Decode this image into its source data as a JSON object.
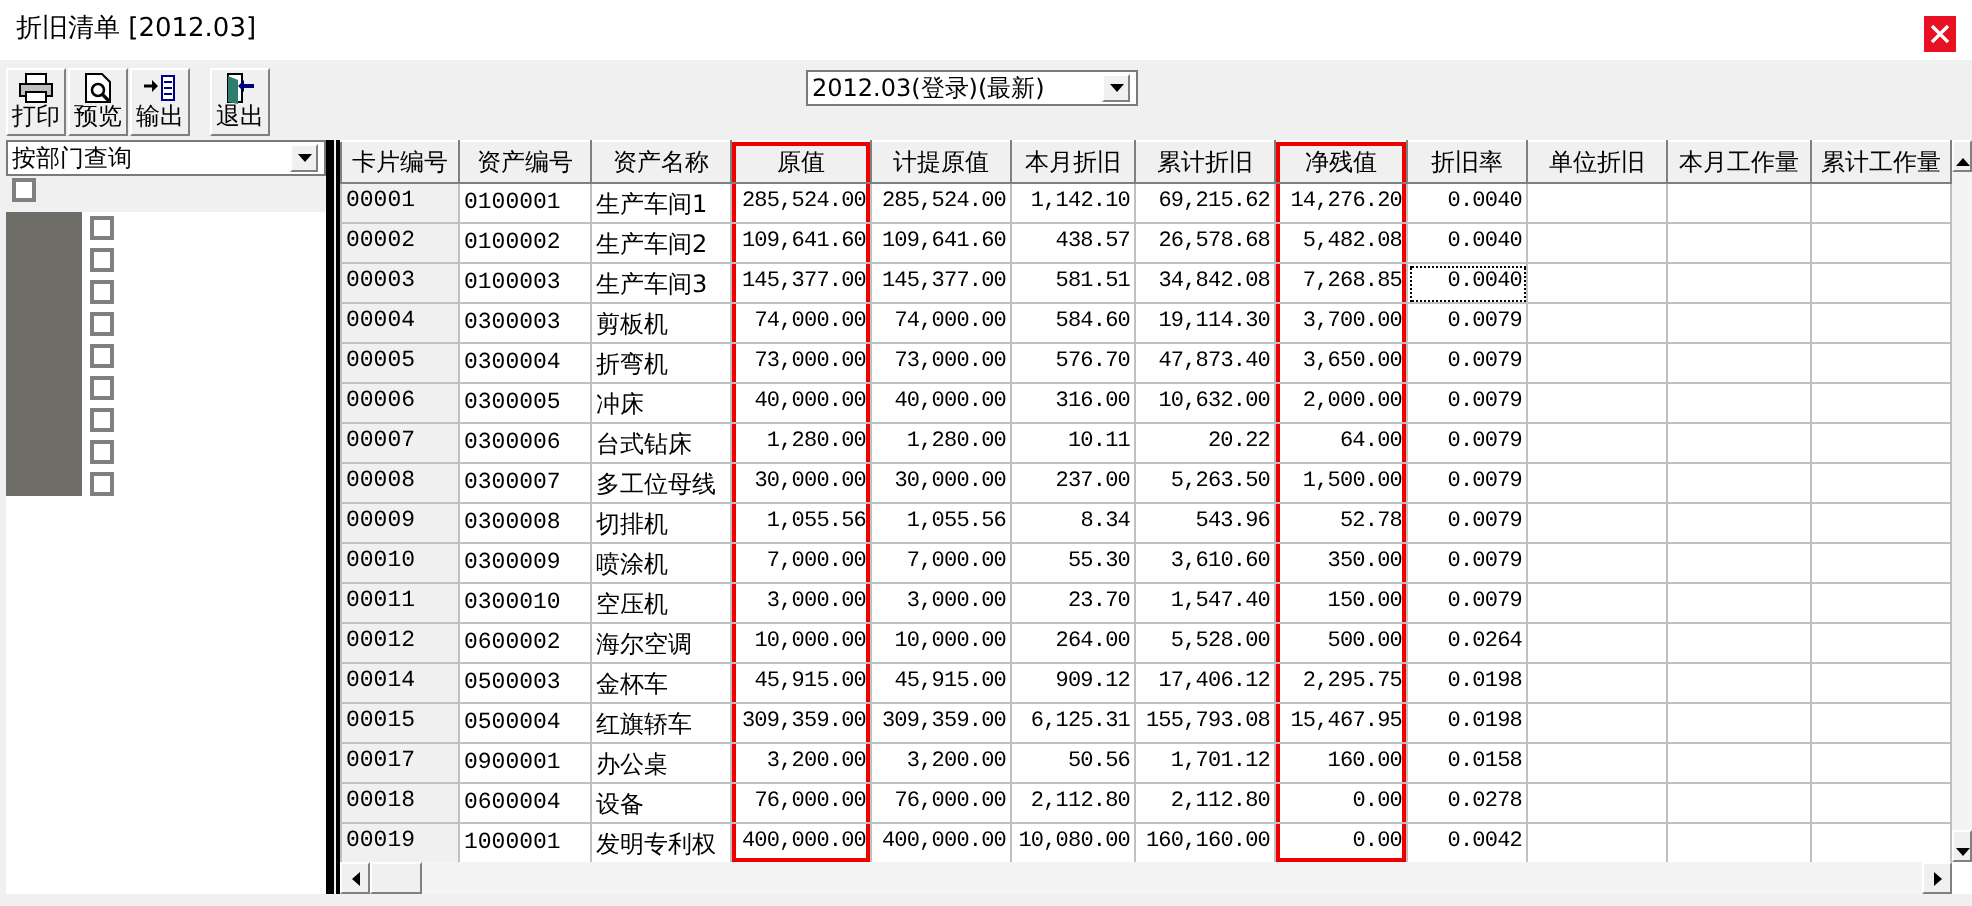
{
  "window": {
    "title": "折旧清单 [2012.03]"
  },
  "toolbar": [
    {
      "label": "打印",
      "kind": "print"
    },
    {
      "label": "预览",
      "kind": "preview"
    },
    {
      "label": "输出",
      "kind": "export"
    },
    {
      "label": "退出",
      "kind": "exit"
    }
  ],
  "period_select": {
    "value": "2012.03(登录)(最新)"
  },
  "filter_select": {
    "value": "按部门查询"
  },
  "tree": {
    "checked": false,
    "children": [
      {
        "checked": false
      },
      {
        "checked": false
      },
      {
        "checked": false
      },
      {
        "checked": false
      },
      {
        "checked": false
      },
      {
        "checked": false
      },
      {
        "checked": false
      },
      {
        "checked": false
      },
      {
        "checked": false
      }
    ]
  },
  "table": {
    "columns": [
      {
        "label": "卡片编号",
        "kind": "key",
        "highlighted": false
      },
      {
        "label": "资产编号",
        "kind": "text",
        "highlighted": false
      },
      {
        "label": "资产名称",
        "kind": "text",
        "highlighted": false
      },
      {
        "label": "原值",
        "kind": "number",
        "highlighted": true
      },
      {
        "label": "计提原值",
        "kind": "number",
        "highlighted": false
      },
      {
        "label": "本月折旧",
        "kind": "number",
        "highlighted": false
      },
      {
        "label": "累计折旧",
        "kind": "number",
        "highlighted": false
      },
      {
        "label": "净残值",
        "kind": "number",
        "highlighted": true
      },
      {
        "label": "折旧率",
        "kind": "number",
        "highlighted": false
      },
      {
        "label": "单位折旧",
        "kind": "number",
        "highlighted": false
      },
      {
        "label": "本月工作量",
        "kind": "number",
        "highlighted": false
      },
      {
        "label": "累计工作量",
        "kind": "number",
        "highlighted": false
      }
    ],
    "rows": [
      {
        "cells": [
          {
            "text": "00001",
            "focused": false
          },
          {
            "text": "0100001",
            "focused": false
          },
          {
            "text": "生产车间1",
            "focused": false
          },
          {
            "text": "285,524.00",
            "focused": false
          },
          {
            "text": "285,524.00",
            "focused": false
          },
          {
            "text": "1,142.10",
            "focused": false
          },
          {
            "text": "69,215.62",
            "focused": false
          },
          {
            "text": "14,276.20",
            "focused": false
          },
          {
            "text": "0.0040",
            "focused": false
          }
        ]
      },
      {
        "cells": [
          {
            "text": "00002",
            "focused": false
          },
          {
            "text": "0100002",
            "focused": false
          },
          {
            "text": "生产车间2",
            "focused": false
          },
          {
            "text": "109,641.60",
            "focused": false
          },
          {
            "text": "109,641.60",
            "focused": false
          },
          {
            "text": "438.57",
            "focused": false
          },
          {
            "text": "26,578.68",
            "focused": false
          },
          {
            "text": "5,482.08",
            "focused": false
          },
          {
            "text": "0.0040",
            "focused": false
          }
        ]
      },
      {
        "cells": [
          {
            "text": "00003",
            "focused": false
          },
          {
            "text": "0100003",
            "focused": false
          },
          {
            "text": "生产车间3",
            "focused": false
          },
          {
            "text": "145,377.00",
            "focused": false
          },
          {
            "text": "145,377.00",
            "focused": false
          },
          {
            "text": "581.51",
            "focused": false
          },
          {
            "text": "34,842.08",
            "focused": false
          },
          {
            "text": "7,268.85",
            "focused": false
          },
          {
            "text": "0.0040",
            "focused": true
          }
        ]
      },
      {
        "cells": [
          {
            "text": "00004",
            "focused": false
          },
          {
            "text": "0300003",
            "focused": false
          },
          {
            "text": "剪板机",
            "focused": false
          },
          {
            "text": "74,000.00",
            "focused": false
          },
          {
            "text": "74,000.00",
            "focused": false
          },
          {
            "text": "584.60",
            "focused": false
          },
          {
            "text": "19,114.30",
            "focused": false
          },
          {
            "text": "3,700.00",
            "focused": false
          },
          {
            "text": "0.0079",
            "focused": false
          }
        ]
      },
      {
        "cells": [
          {
            "text": "00005",
            "focused": false
          },
          {
            "text": "0300004",
            "focused": false
          },
          {
            "text": "折弯机",
            "focused": false
          },
          {
            "text": "73,000.00",
            "focused": false
          },
          {
            "text": "73,000.00",
            "focused": false
          },
          {
            "text": "576.70",
            "focused": false
          },
          {
            "text": "47,873.40",
            "focused": false
          },
          {
            "text": "3,650.00",
            "focused": false
          },
          {
            "text": "0.0079",
            "focused": false
          }
        ]
      },
      {
        "cells": [
          {
            "text": "00006",
            "focused": false
          },
          {
            "text": "0300005",
            "focused": false
          },
          {
            "text": "冲床",
            "focused": false
          },
          {
            "text": "40,000.00",
            "focused": false
          },
          {
            "text": "40,000.00",
            "focused": false
          },
          {
            "text": "316.00",
            "focused": false
          },
          {
            "text": "10,632.00",
            "focused": false
          },
          {
            "text": "2,000.00",
            "focused": false
          },
          {
            "text": "0.0079",
            "focused": false
          }
        ]
      },
      {
        "cells": [
          {
            "text": "00007",
            "focused": false
          },
          {
            "text": "0300006",
            "focused": false
          },
          {
            "text": "台式钻床",
            "focused": false
          },
          {
            "text": "1,280.00",
            "focused": false
          },
          {
            "text": "1,280.00",
            "focused": false
          },
          {
            "text": "10.11",
            "focused": false
          },
          {
            "text": "20.22",
            "focused": false
          },
          {
            "text": "64.00",
            "focused": false
          },
          {
            "text": "0.0079",
            "focused": false
          }
        ]
      },
      {
        "cells": [
          {
            "text": "00008",
            "focused": false
          },
          {
            "text": "0300007",
            "focused": false
          },
          {
            "text": "多工位母线",
            "focused": false
          },
          {
            "text": "30,000.00",
            "focused": false
          },
          {
            "text": "30,000.00",
            "focused": false
          },
          {
            "text": "237.00",
            "focused": false
          },
          {
            "text": "5,263.50",
            "focused": false
          },
          {
            "text": "1,500.00",
            "focused": false
          },
          {
            "text": "0.0079",
            "focused": false
          }
        ]
      },
      {
        "cells": [
          {
            "text": "00009",
            "focused": false
          },
          {
            "text": "0300008",
            "focused": false
          },
          {
            "text": "切排机",
            "focused": false
          },
          {
            "text": "1,055.56",
            "focused": false
          },
          {
            "text": "1,055.56",
            "focused": false
          },
          {
            "text": "8.34",
            "focused": false
          },
          {
            "text": "543.96",
            "focused": false
          },
          {
            "text": "52.78",
            "focused": false
          },
          {
            "text": "0.0079",
            "focused": false
          }
        ]
      },
      {
        "cells": [
          {
            "text": "00010",
            "focused": false
          },
          {
            "text": "0300009",
            "focused": false
          },
          {
            "text": "喷涂机",
            "focused": false
          },
          {
            "text": "7,000.00",
            "focused": false
          },
          {
            "text": "7,000.00",
            "focused": false
          },
          {
            "text": "55.30",
            "focused": false
          },
          {
            "text": "3,610.60",
            "focused": false
          },
          {
            "text": "350.00",
            "focused": false
          },
          {
            "text": "0.0079",
            "focused": false
          }
        ]
      },
      {
        "cells": [
          {
            "text": "00011",
            "focused": false
          },
          {
            "text": "0300010",
            "focused": false
          },
          {
            "text": "空压机",
            "focused": false
          },
          {
            "text": "3,000.00",
            "focused": false
          },
          {
            "text": "3,000.00",
            "focused": false
          },
          {
            "text": "23.70",
            "focused": false
          },
          {
            "text": "1,547.40",
            "focused": false
          },
          {
            "text": "150.00",
            "focused": false
          },
          {
            "text": "0.0079",
            "focused": false
          }
        ]
      },
      {
        "cells": [
          {
            "text": "00012",
            "focused": false
          },
          {
            "text": "0600002",
            "focused": false
          },
          {
            "text": "海尔空调",
            "focused": false
          },
          {
            "text": "10,000.00",
            "focused": false
          },
          {
            "text": "10,000.00",
            "focused": false
          },
          {
            "text": "264.00",
            "focused": false
          },
          {
            "text": "5,528.00",
            "focused": false
          },
          {
            "text": "500.00",
            "focused": false
          },
          {
            "text": "0.0264",
            "focused": false
          }
        ]
      },
      {
        "cells": [
          {
            "text": "00014",
            "focused": false
          },
          {
            "text": "0500003",
            "focused": false
          },
          {
            "text": "金杯车",
            "focused": false
          },
          {
            "text": "45,915.00",
            "focused": false
          },
          {
            "text": "45,915.00",
            "focused": false
          },
          {
            "text": "909.12",
            "focused": false
          },
          {
            "text": "17,406.12",
            "focused": false
          },
          {
            "text": "2,295.75",
            "focused": false
          },
          {
            "text": "0.0198",
            "focused": false
          }
        ]
      },
      {
        "cells": [
          {
            "text": "00015",
            "focused": false
          },
          {
            "text": "0500004",
            "focused": false
          },
          {
            "text": "红旗轿车",
            "focused": false
          },
          {
            "text": "309,359.00",
            "focused": false
          },
          {
            "text": "309,359.00",
            "focused": false
          },
          {
            "text": "6,125.31",
            "focused": false
          },
          {
            "text": "155,793.08",
            "focused": false
          },
          {
            "text": "15,467.95",
            "focused": false
          },
          {
            "text": "0.0198",
            "focused": false
          }
        ]
      },
      {
        "cells": [
          {
            "text": "00017",
            "focused": false
          },
          {
            "text": "0900001",
            "focused": false
          },
          {
            "text": "办公桌",
            "focused": false
          },
          {
            "text": "3,200.00",
            "focused": false
          },
          {
            "text": "3,200.00",
            "focused": false
          },
          {
            "text": "50.56",
            "focused": false
          },
          {
            "text": "1,701.12",
            "focused": false
          },
          {
            "text": "160.00",
            "focused": false
          },
          {
            "text": "0.0158",
            "focused": false
          }
        ]
      },
      {
        "cells": [
          {
            "text": "00018",
            "focused": false
          },
          {
            "text": "0600004",
            "focused": false
          },
          {
            "text": "设备",
            "focused": false
          },
          {
            "text": "76,000.00",
            "focused": false
          },
          {
            "text": "76,000.00",
            "focused": false
          },
          {
            "text": "2,112.80",
            "focused": false
          },
          {
            "text": "2,112.80",
            "focused": false
          },
          {
            "text": "0.00",
            "focused": false
          },
          {
            "text": "0.0278",
            "focused": false
          }
        ]
      },
      {
        "cells": [
          {
            "text": "00019",
            "focused": false
          },
          {
            "text": "1000001",
            "focused": false
          },
          {
            "text": "发明专利权",
            "focused": false
          },
          {
            "text": "400,000.00",
            "focused": false
          },
          {
            "text": "400,000.00",
            "focused": false
          },
          {
            "text": "10,080.00",
            "focused": false
          },
          {
            "text": "160,160.00",
            "focused": false
          },
          {
            "text": "0.00",
            "focused": false
          },
          {
            "text": "0.0042",
            "focused": false
          }
        ]
      }
    ]
  }
}
